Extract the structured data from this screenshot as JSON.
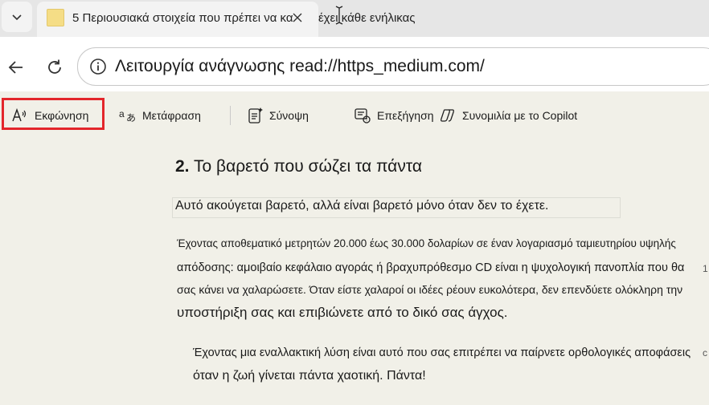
{
  "browser": {
    "tab": {
      "title": "5 Περιουσιακά στοιχεία που πρέπει να κατέχει κάθε ενήλικας",
      "title_visible": "5 Περιουσιακά στοιχεία που πρέπει να κα",
      "title_rest": "έχει κάθε ενήλικας"
    },
    "address": {
      "url": "Λειτουργία ανάγνωσης read://https_medium.com/"
    }
  },
  "reader_toolbar": {
    "read_aloud": "Εκφώνηση",
    "translate": "Μετάφραση",
    "summarize": "Σύνοψη",
    "explain": "Επεξήγηση",
    "copilot_chat": "Συνομιλία με το Copilot"
  },
  "article": {
    "heading_number": "2.",
    "heading_text": "Το βαρετό που σώζει τα πάντα",
    "intro": "Αυτό ακούγεται βαρετό, αλλά είναι βαρετό μόνο όταν δεν το έχετε.",
    "para1_line1": "Έχοντας αποθεματικό μετρητών 20.000 έως 30.000 δολαρίων σε έναν λογαριασμό ταμιευτηρίου υψηλής",
    "para1_line2": "απόδοσης: αμοιβαίο κεφάλαιο αγοράς ή βραχυπρόθεσμο CD είναι η ψυχολογική πανοπλία που θα",
    "para1_line3": "σας κάνει να χαλαρώσετε. Όταν είστε χαλαροί οι ιδέες ρέουν ευκολότερα, δεν επενδύετε ολόκληρη την",
    "para1_line4": "υποστήριξη σας και επιβιώνετε από το δικό σας άγχος.",
    "para2_line1": "Έχοντας μια εναλλακτική λύση είναι αυτό που σας επιτρέπει να παίρνετε ορθολογικές αποφάσεις",
    "para2_line2": "όταν η ζωή γίνεται πάντα χαοτική. Πάντα!",
    "margin_mark1": "1",
    "margin_mark2": "c"
  }
}
